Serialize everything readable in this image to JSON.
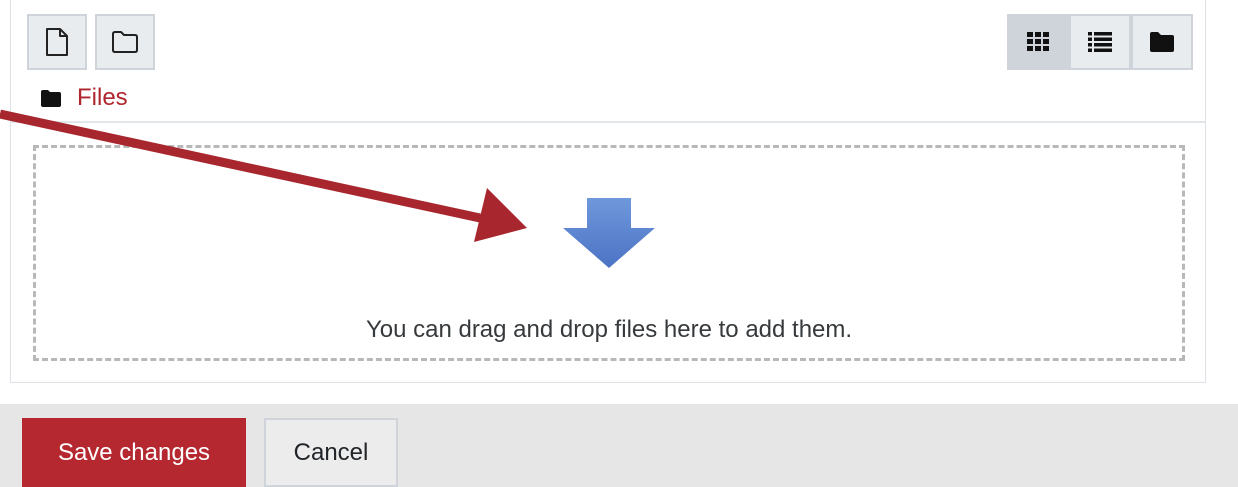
{
  "toolbar": {
    "add_file_icon": "file-icon",
    "create_folder_icon": "folder-icon",
    "views": [
      {
        "name": "grid-view-icon",
        "active": true
      },
      {
        "name": "list-view-icon",
        "active": false
      },
      {
        "name": "tree-view-icon",
        "active": false
      }
    ]
  },
  "breadcrumb": {
    "label": "Files"
  },
  "dropzone": {
    "message": "You can drag and drop files here to add them."
  },
  "actions": {
    "save_label": "Save changes",
    "cancel_label": "Cancel"
  },
  "colors": {
    "accent": "#b5282f",
    "link": "#b0262e",
    "drop_arrow": "#5b86d6",
    "annotation_arrow": "#a8262d"
  }
}
